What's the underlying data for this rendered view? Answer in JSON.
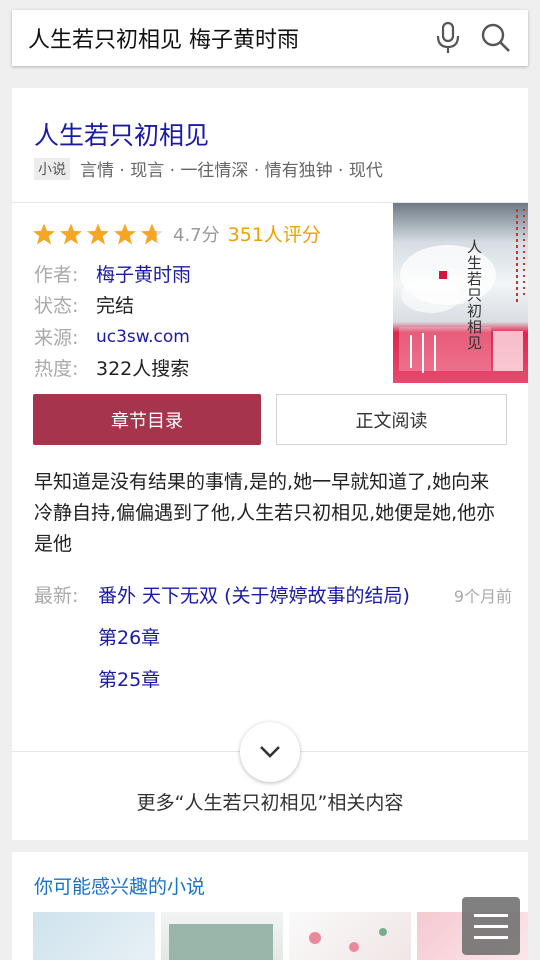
{
  "search": {
    "query": "人生若只初相见 梅子黄时雨",
    "mic_icon": "microphone-icon",
    "search_icon": "search-icon"
  },
  "book": {
    "title": "人生若只初相见",
    "tag_badge": "小说",
    "tags": "言情 · 现言 · 一往情深 · 情有独钟 · 现代",
    "rating": {
      "stars": 4.7,
      "max_stars": 5,
      "score_text": "4.7分",
      "count_text": "351人评分",
      "star_color": "#f5a623"
    },
    "author_label": "作者:",
    "author": "梅子黄时雨",
    "status_label": "状态:",
    "status": "完结",
    "source_label": "来源:",
    "source": "uc3sw.com",
    "heat_label": "热度:",
    "heat": "322人搜索",
    "cover_title": "人生若只初相见"
  },
  "actions": {
    "chapters_label": "章节目录",
    "read_label": "正文阅读",
    "primary_color": "#a5344c"
  },
  "description": "早知道是没有结果的事情,是的,她一早就知道了,她向来冷静自持,偏偏遇到了他,人生若只初相见,她便是她,他亦是他",
  "latest": {
    "label": "最新:",
    "title": "番外 天下无双 (关于婷婷故事的结局)",
    "time": "9个月前",
    "chapters": [
      "第26章",
      "第25章"
    ]
  },
  "more_text": "更多“人生若只初相见”相关内容",
  "recommend": {
    "title": "你可能感兴趣的小说"
  },
  "fab_icon": "menu-icon"
}
